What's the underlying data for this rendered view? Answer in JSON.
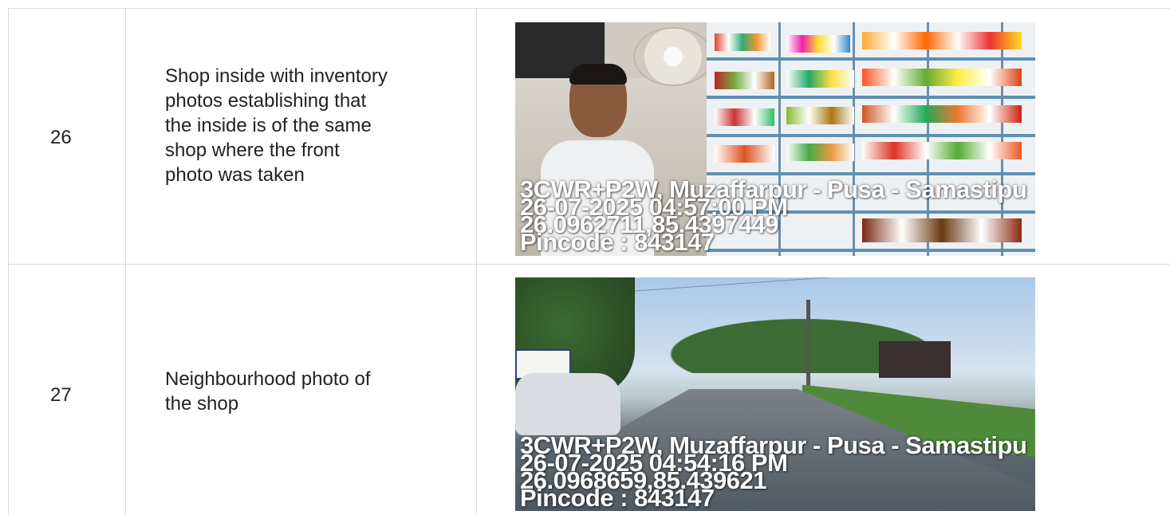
{
  "rows": [
    {
      "number": "26",
      "description": "Shop inside with inventory\nphotos establishing that\nthe inside is of the same\nshop where the front\nphoto was taken",
      "photo": {
        "subject": "shop-interior",
        "overlay": [
          "3CWR+P2W, Muzaffarpur - Pusa - Samastipu",
          "26-07-2025 04:57:00 PM",
          "26.0962711,85.4397449",
          "Pincode : 843147"
        ]
      }
    },
    {
      "number": "27",
      "description": "Neighbourhood photo of\nthe shop",
      "photo": {
        "subject": "street-neighbourhood",
        "overlay": [
          "3CWR+P2W, Muzaffarpur - Pusa - Samastipu",
          "26-07-2025 04:54:16 PM",
          "26.0968659,85.439621",
          "Pincode : 843147"
        ]
      }
    }
  ],
  "colors": {
    "border": "#d9d9d9",
    "text": "#222222",
    "overlay_text": "#ffffff"
  }
}
